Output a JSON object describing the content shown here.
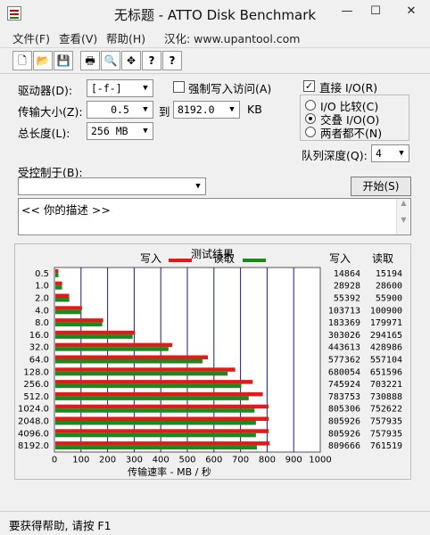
{
  "window": {
    "title": "无标题 - ATTO Disk Benchmark",
    "minimize": "—",
    "maximize": "☐",
    "close": "✕"
  },
  "menu": {
    "file": "文件(F)",
    "view": "查看(V)",
    "help": "帮助(H)",
    "localized": "汉化: www.upantool.com"
  },
  "toolbar": {
    "new": "🗋",
    "open": "📂",
    "save": "💾",
    "print": "🖶",
    "preview": "🔍",
    "move": "✥",
    "help": "?",
    "context_help": "?"
  },
  "form": {
    "drive_label": "驱动器(D):",
    "drive_value": "[-f-]",
    "force_write_label": "强制写入访问(A)",
    "transfer_label": "传输大小(Z):",
    "transfer_from": "0.5",
    "to_label": "到",
    "transfer_to": "8192.0",
    "kb_label": "KB",
    "length_label": "总长度(L):",
    "length_value": "256 MB",
    "direct_io_label": "直接 I/O(R)",
    "direct_io_checked": "✓",
    "io_compare_label": "I/O 比较(C)",
    "overlap_io_label": "交叠 I/O(O)",
    "neither_label": "两者都不(N)",
    "queue_label": "队列深度(Q):",
    "queue_value": "4",
    "controlled_label": "受控制于(B):",
    "controlled_value": "",
    "start_button": "开始(S)",
    "description": "<<    你的描述    >>"
  },
  "results": {
    "title": "测试结果",
    "write_legend": "写入",
    "read_legend": "读取",
    "col_write": "写入",
    "col_read": "读取"
  },
  "chart_data": {
    "type": "bar",
    "orientation": "horizontal",
    "title": "测试结果",
    "xlabel": "传输速率 - MB / 秒",
    "xlim": [
      0,
      1000
    ],
    "x_ticks": [
      "0",
      "100",
      "200",
      "300",
      "400",
      "500",
      "600",
      "700",
      "800",
      "900",
      "1000"
    ],
    "categories": [
      "0.5",
      "1.0",
      "2.0",
      "4.0",
      "8.0",
      "16.0",
      "32.0",
      "64.0",
      "128.0",
      "256.0",
      "512.0",
      "1024.0",
      "2048.0",
      "4096.0",
      "8192.0"
    ],
    "series": [
      {
        "name": "写入",
        "color": "#e31a1a",
        "values": [
          14864,
          28928,
          55392,
          103713,
          183369,
          303026,
          443613,
          577362,
          680054,
          745924,
          783753,
          805306,
          805926,
          805926,
          809666
        ]
      },
      {
        "name": "读取",
        "color": "#1a8a1a",
        "values": [
          15194,
          28600,
          55900,
          100900,
          179971,
          294165,
          428986,
          557104,
          651596,
          703221,
          730888,
          752622,
          757935,
          757935,
          761519
        ]
      }
    ],
    "value_unit_divisor": 1000,
    "grid": "vertical"
  },
  "status": {
    "text": "要获得帮助, 请按 F1"
  }
}
